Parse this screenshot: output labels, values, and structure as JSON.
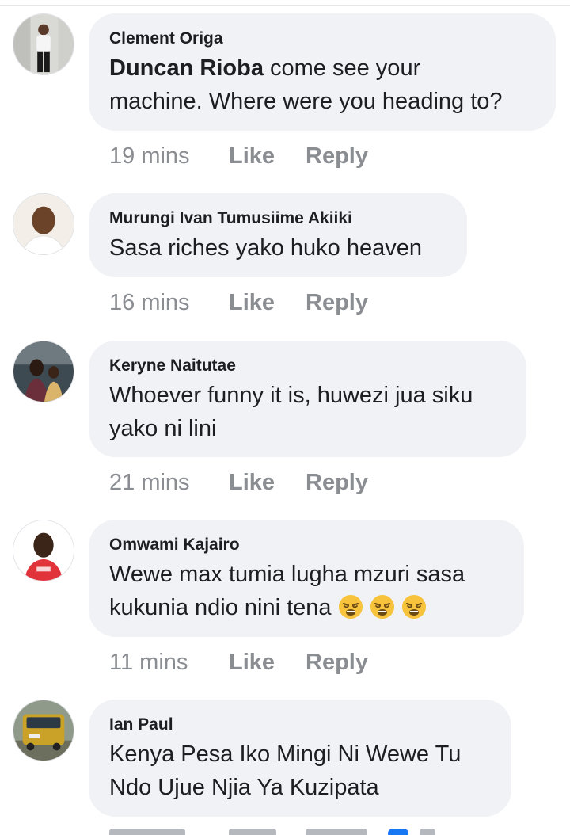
{
  "comments": [
    {
      "author": "Clement Origa",
      "mention": "Duncan Rioba",
      "line1_rest": " come see your",
      "line2": "machine. Where were you heading to?",
      "time": "19 mins",
      "like": "Like",
      "reply": "Reply"
    },
    {
      "author": "Murungi Ivan Tumusiime Akiiki",
      "line1": "Sasa riches yako huko heaven",
      "time": "16 mins",
      "like": "Like",
      "reply": "Reply"
    },
    {
      "author": "Keryne Naitutae",
      "line1": "Whoever funny it is, huwezi jua siku",
      "line2": "yako ni lini",
      "time": "21 mins",
      "like": "Like",
      "reply": "Reply"
    },
    {
      "author": "Omwami Kajairo",
      "line1": "Wewe max tumia lugha mzuri sasa",
      "line2": "kukunia ndio nini tena",
      "emojis": [
        "weary-face-icon",
        "weary-face-icon",
        "weary-face-icon"
      ],
      "time": "11 mins",
      "like": "Like",
      "reply": "Reply"
    },
    {
      "author": "Ian Paul",
      "line1": "Kenya Pesa Iko Mingi Ni Wewe Tu",
      "line2": "Ndo Ujue Njia Ya Kuzipata"
    }
  ],
  "colors": {
    "bubble": "#f0f2f5",
    "text": "#1c1e21",
    "meta": "#8a8d91",
    "reaction_blue": "#1877f2"
  }
}
